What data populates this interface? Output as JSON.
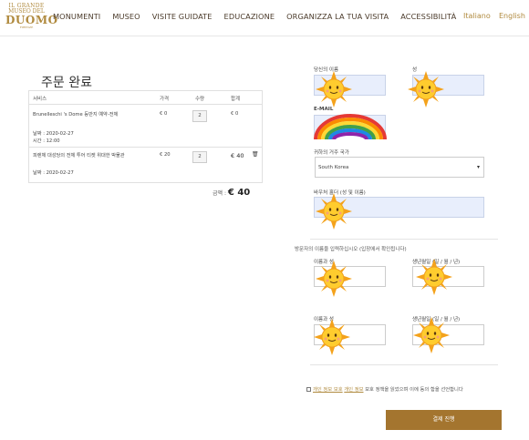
{
  "header": {
    "logo": {
      "line1": "IL GRANDE",
      "line2": "MUSEO DEL",
      "line3": "DUOMO",
      "line4": "FIRENZE"
    },
    "nav": [
      "MONUMENTI",
      "MUSEO",
      "VISITE GUIDATE",
      "EDUCAZIONE",
      "ORGANIZZA LA TUA VISITA",
      "ACCESSIBILITÀ"
    ],
    "languages": {
      "it": "Italiano",
      "en": "English"
    }
  },
  "order": {
    "title": "주문 완료",
    "columns": {
      "service": "서비스",
      "price": "가격",
      "quantity": "수량",
      "total": "합계"
    },
    "items": [
      {
        "name": "Brunelleschi 's Dome 등반지 예약-전체",
        "price": "€ 0",
        "quantity": "2",
        "total": "€ 0",
        "date": "날짜 : 2020-02-27",
        "time": "시간 : 12:00"
      },
      {
        "name": "피렌체 대성당의 전체 투어 티켓 위대한 박물관",
        "price": "€ 20",
        "quantity": "2",
        "total": "€ 40",
        "date": "날짜 : 2020-02-27"
      }
    ],
    "amount_label": "금액 :",
    "amount_value": "€ 40"
  },
  "form": {
    "first_name_label": "당신의 이름",
    "last_name_label": "성",
    "email_label": "E-MAIL",
    "country_label": "귀하의 거주 국가",
    "country_value": "South Korea",
    "billing_name_label": "바우처 홀더 (성 및 이름)",
    "visitors_note": "방문자의 이름을 입력하십시오 (입장에서 확인됩니다)",
    "visitor1": {
      "name_label": "이름과 성",
      "birth_label": "생년월일 (일 / 월 / 년)"
    },
    "visitor2": {
      "name_label": "이름과 성",
      "birth_label": "생년월일 (일 / 월 / 년)"
    },
    "consent_prefix": "",
    "consent_link1": "개인 정보 보호",
    "consent_link2": "개인 정보",
    "consent_text": "보호 정책을 읽었으며 이에 동의 함을 선언합니다",
    "pay_button": "결제 진행"
  },
  "colors": {
    "accent": "#b08a3e",
    "button": "#a4752f",
    "input_fill": "#e8eefc"
  }
}
